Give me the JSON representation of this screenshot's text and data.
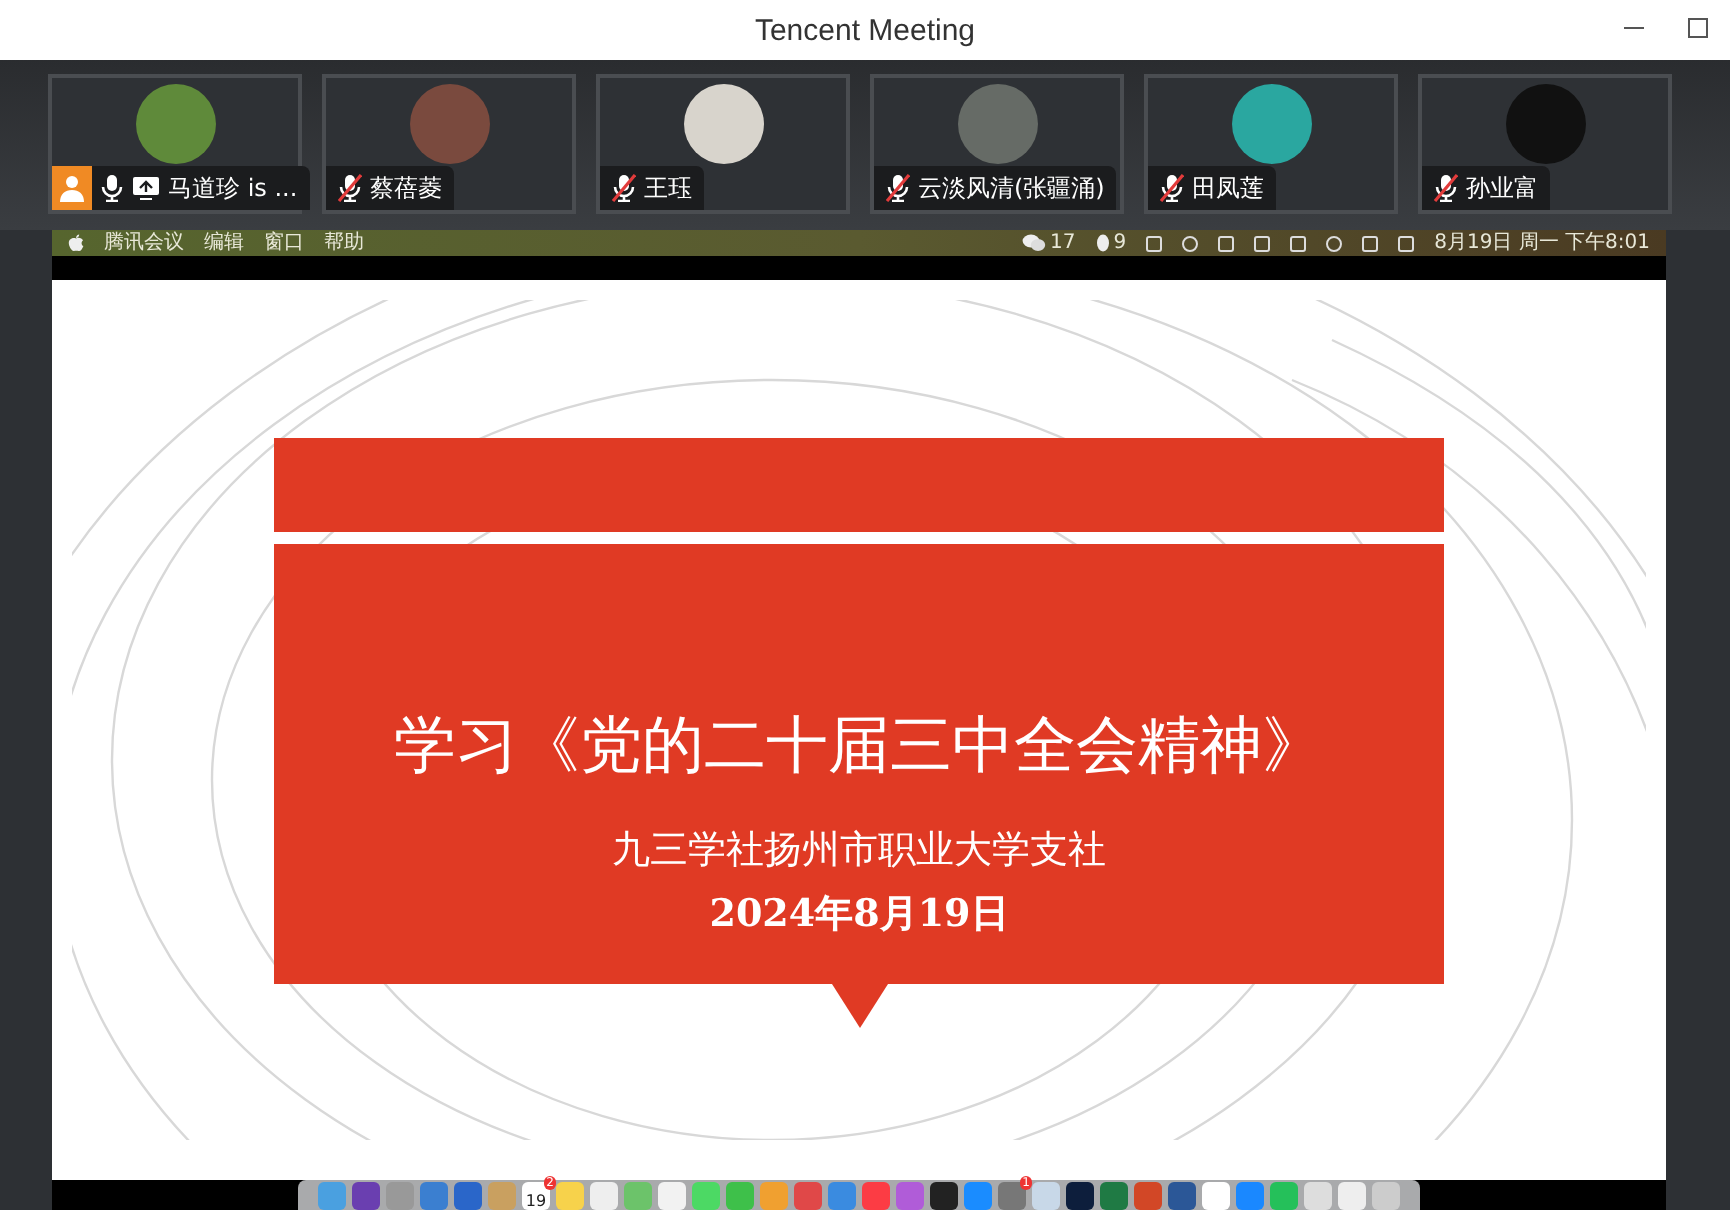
{
  "window": {
    "title": "Tencent Meeting"
  },
  "participants": [
    {
      "name": "马道珍 is ...",
      "host": true,
      "muted": false,
      "sharing": true
    },
    {
      "name": "蔡蓓菱",
      "host": false,
      "muted": true,
      "sharing": false
    },
    {
      "name": "王珏",
      "host": false,
      "muted": true,
      "sharing": false
    },
    {
      "name": "云淡风清(张疆涌)",
      "host": false,
      "muted": true,
      "sharing": false
    },
    {
      "name": "田凤莲",
      "host": false,
      "muted": true,
      "sharing": false
    },
    {
      "name": "孙业富",
      "host": false,
      "muted": true,
      "sharing": false
    }
  ],
  "shared_screen": {
    "menu_bar": {
      "menus": [
        "腾讯会议",
        "编辑",
        "窗口",
        "帮助"
      ],
      "wechat_count": "17",
      "qq_count": "9",
      "clock": "8月19日 周一 下午8:01"
    },
    "slide": {
      "title": "学习《党的二十届三中全会精神》",
      "organization": "九三学社扬州市职业大学支社",
      "date": "2024年8月19日"
    },
    "dock": {
      "calendar_day": "19",
      "calendar_badge": "2",
      "settings_badge": "1"
    }
  }
}
